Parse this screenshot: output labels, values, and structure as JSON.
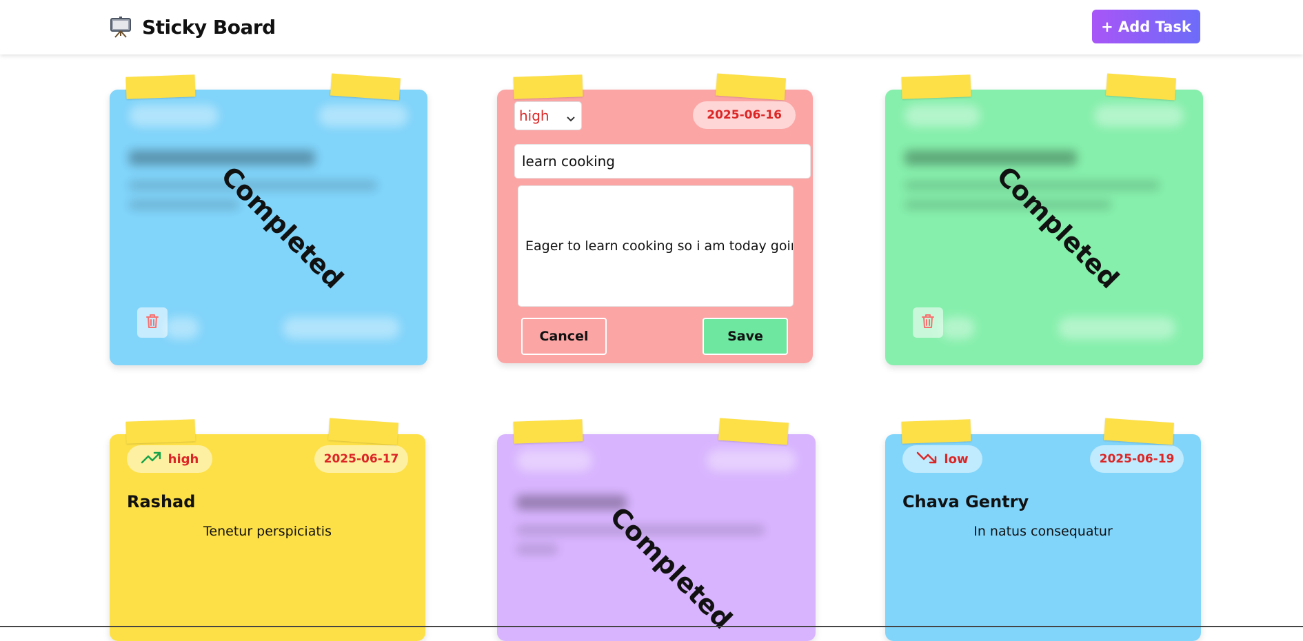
{
  "app": {
    "title": "Sticky Board",
    "icon": "presentation-board-icon"
  },
  "header": {
    "add_button_label": "+ Add Task"
  },
  "colors": {
    "blue": "#81d4fa",
    "red": "#fca5a5",
    "green": "#86efac",
    "yellow": "#fde047",
    "purple": "#d8b4fe",
    "tape": "#fde047",
    "accent_gradient_start": "#a855f7",
    "accent_gradient_end": "#6d6cf8",
    "priority_text": "#dc2626",
    "trend_up": "#16a34a",
    "save_button": "#6ee7a1"
  },
  "notes": [
    {
      "id": "note-1",
      "color": "blue",
      "state": "completed",
      "overlay_text": "Completed",
      "delete_icon": "trash-icon"
    },
    {
      "id": "note-2",
      "color": "red",
      "state": "editing",
      "priority_value": "high",
      "date": "2025-06-16",
      "title_value": "learn cooking",
      "description_value": "Eager to learn cooking so i am today going",
      "cancel_label": "Cancel",
      "save_label": "Save"
    },
    {
      "id": "note-3",
      "color": "green",
      "state": "completed",
      "overlay_text": "Completed",
      "delete_icon": "trash-icon"
    },
    {
      "id": "note-4",
      "color": "yellow",
      "state": "active",
      "priority": "high",
      "priority_icon": "trending-up-icon",
      "date": "2025-06-17",
      "title": "Rashad",
      "description": "Tenetur perspiciatis"
    },
    {
      "id": "note-5",
      "color": "purple",
      "state": "completed",
      "overlay_text": "Completed"
    },
    {
      "id": "note-6",
      "color": "blue",
      "state": "active",
      "priority": "low",
      "priority_icon": "trending-down-icon",
      "date": "2025-06-19",
      "title": "Chava Gentry",
      "description": "In natus consequatur"
    }
  ]
}
